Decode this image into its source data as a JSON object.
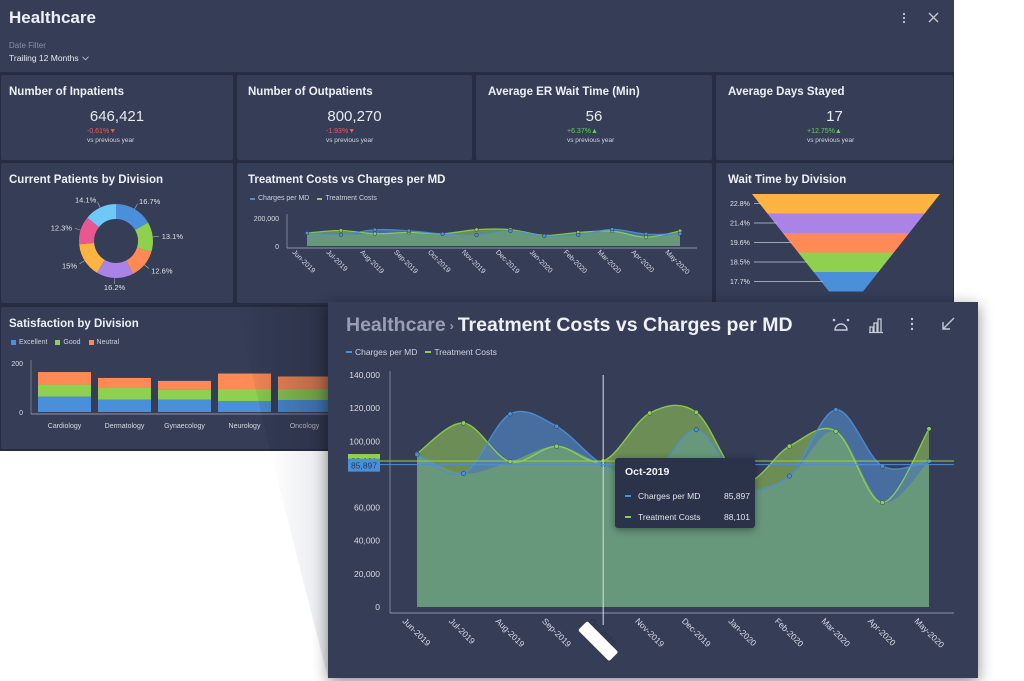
{
  "app": {
    "title": "Healthcare",
    "date_filter_label": "Date Filter",
    "date_filter_value": "Trailing 12 Months",
    "more_icon": "vertical-ellipsis-icon",
    "close_icon": "close-icon"
  },
  "colors": {
    "background": "#262d42",
    "card": "#353d57",
    "negative": "#ef5a5a",
    "positive": "#5fd35f",
    "charges": "#4a8fd9",
    "treatment": "#8fd14f"
  },
  "kpis": [
    {
      "title": "Number of Inpatients",
      "value": "646,421",
      "delta": "-0.61%",
      "direction": "down",
      "sub": "vs previous year"
    },
    {
      "title": "Number of Outpatients",
      "value": "800,270",
      "delta": "-1.93%",
      "direction": "down",
      "sub": "vs previous year"
    },
    {
      "title": "Average ER Wait Time (Min)",
      "value": "56",
      "delta": "+6.37%",
      "direction": "up",
      "sub": "vs previous year"
    },
    {
      "title": "Average Days Stayed",
      "value": "17",
      "delta": "+12.75%",
      "direction": "up",
      "sub": "vs previous year"
    }
  ],
  "donut": {
    "title": "Current Patients by Division"
  },
  "small_line": {
    "title": "Treatment Costs vs Charges per MD",
    "legend": [
      "Charges per MD",
      "Treatment Costs"
    ],
    "y_ticks": [
      "200,000",
      "0"
    ]
  },
  "funnel": {
    "title": "Wait Time by Division"
  },
  "satisfaction": {
    "title": "Satisfaction by Division",
    "legend": [
      "Excellent",
      "Good",
      "Neutral"
    ],
    "y_ticks": [
      "200",
      "0"
    ]
  },
  "expanded": {
    "breadcrumb_root": "Healthcare",
    "breadcrumb_separator": "›",
    "title": "Treatment Costs vs Charges per MD",
    "legend": [
      "Charges per MD",
      "Treatment Costs"
    ],
    "icons": [
      "sparkle-refresh-icon",
      "bar-chart-icon",
      "vertical-ellipsis-icon",
      "collapse-arrow-icon"
    ],
    "crosshair": {
      "category": "Oct-2019",
      "charges_label": "85,897",
      "treatment_label": "88,101"
    },
    "tooltip": {
      "title": "Oct-2019",
      "rows": [
        {
          "label": "Charges per MD",
          "value": "85,897"
        },
        {
          "label": "Treatment Costs",
          "value": "88,101"
        }
      ]
    }
  },
  "chart_data": [
    {
      "type": "pie",
      "title": "Current Patients by Division",
      "variant": "donut",
      "labels": [
        "16.7%",
        "13.1%",
        "12.6%",
        "16.2%",
        "15%",
        "12.3%",
        "14.1%"
      ],
      "values": [
        16.7,
        13.1,
        12.6,
        16.2,
        15.0,
        12.3,
        14.1
      ],
      "colors": [
        "#4a8fd9",
        "#8fd14f",
        "#ff8a55",
        "#a983e6",
        "#ffb340",
        "#e8578f",
        "#6ec9f7"
      ]
    },
    {
      "type": "area",
      "title": "Treatment Costs vs Charges per MD",
      "categories": [
        "Jun-2019",
        "Jul-2019",
        "Aug-2019",
        "Sep-2019",
        "Oct-2019",
        "Nov-2019",
        "Dec-2019",
        "Jan-2020",
        "Feb-2020",
        "Mar-2020",
        "Apr-2020",
        "May-2020"
      ],
      "series": [
        {
          "name": "Charges per MD",
          "values": [
            92000,
            80500,
            116500,
            109000,
            85897,
            78000,
            107000,
            73000,
            79000,
            119000,
            85000,
            88000
          ]
        },
        {
          "name": "Treatment Costs",
          "values": [
            92500,
            111000,
            87700,
            97000,
            88101,
            117000,
            117500,
            76000,
            97000,
            106000,
            63000,
            107500
          ]
        }
      ],
      "ylim": [
        0,
        200000
      ],
      "y_ticks": [
        0,
        200000
      ],
      "xlabel": "",
      "ylabel": "",
      "legend": "top-left"
    },
    {
      "type": "bar",
      "variant": "funnel",
      "title": "Wait Time by Division",
      "labels": [
        "22.8%",
        "21.4%",
        "19.6%",
        "18.5%",
        "17.7%"
      ],
      "values": [
        22.8,
        21.4,
        19.6,
        18.5,
        17.7
      ],
      "colors": [
        "#ffb340",
        "#a983e6",
        "#ff8a55",
        "#8fd14f",
        "#4a8fd9"
      ]
    },
    {
      "type": "bar",
      "variant": "stacked",
      "title": "Satisfaction by Division",
      "categories": [
        "Cardiology",
        "Dermatology",
        "Gynaecology",
        "Neurology",
        "Oncology"
      ],
      "series": [
        {
          "name": "Excellent",
          "color": "#4a8fd9",
          "values": [
            63,
            51,
            51,
            45,
            49
          ]
        },
        {
          "name": "Good",
          "color": "#8fd14f",
          "values": [
            49,
            47,
            39,
            49,
            45
          ]
        },
        {
          "name": "Neutral",
          "color": "#ff8a55",
          "values": [
            51,
            41,
            37,
            63,
            51
          ]
        }
      ],
      "ylim": [
        0,
        200
      ],
      "y_ticks": [
        0,
        200
      ],
      "legend": "top-left"
    },
    {
      "type": "area",
      "title": "Treatment Costs vs Charges per MD (expanded)",
      "categories": [
        "Jun-2019",
        "Jul-2019",
        "Aug-2019",
        "Sep-2019",
        "Oct-2019",
        "Nov-2019",
        "Dec-2019",
        "Jan-2020",
        "Feb-2020",
        "Mar-2020",
        "Apr-2020",
        "May-2020"
      ],
      "series": [
        {
          "name": "Charges per MD",
          "values": [
            92000,
            80500,
            116500,
            109000,
            85897,
            78000,
            107000,
            73000,
            79000,
            119000,
            85000,
            88000
          ]
        },
        {
          "name": "Treatment Costs",
          "values": [
            92500,
            111000,
            87700,
            97000,
            88101,
            117000,
            117500,
            76000,
            97000,
            106000,
            63000,
            107500
          ]
        }
      ],
      "ylim": [
        0,
        140000
      ],
      "y_ticks": [
        0,
        20000,
        40000,
        60000,
        80000,
        100000,
        120000,
        140000
      ],
      "y_tick_labels": [
        "0",
        "20,000",
        "40,000",
        "60,000",
        "",
        "100,000",
        "120,000",
        "140,000"
      ],
      "highlighted_category": "Oct-2019",
      "legend": "top-left"
    }
  ]
}
